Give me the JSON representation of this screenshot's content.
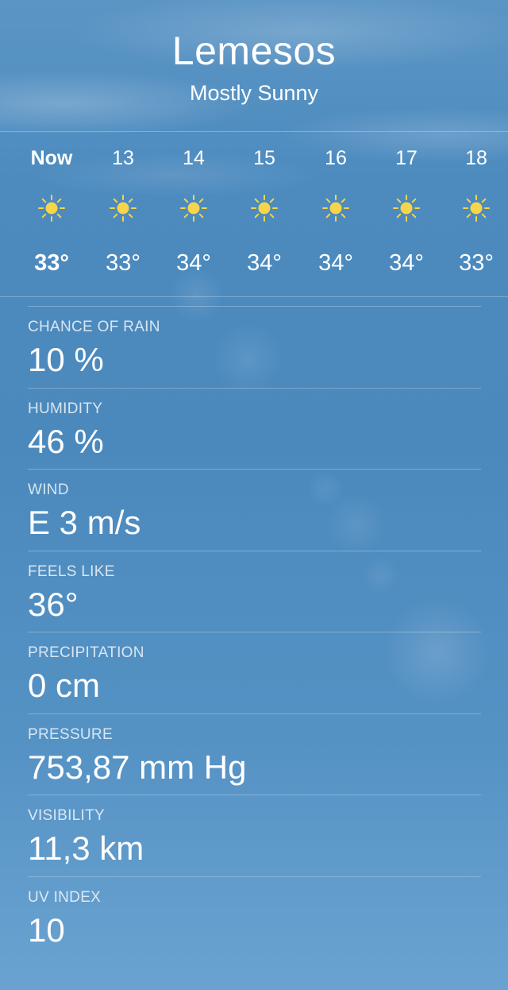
{
  "location": {
    "city": "Lemesos",
    "condition": "Mostly Sunny"
  },
  "hourly": [
    {
      "time": "Now",
      "icon": "sun-icon",
      "temp": "33°"
    },
    {
      "time": "13",
      "icon": "sun-icon",
      "temp": "33°"
    },
    {
      "time": "14",
      "icon": "sun-icon",
      "temp": "34°"
    },
    {
      "time": "15",
      "icon": "sun-icon",
      "temp": "34°"
    },
    {
      "time": "16",
      "icon": "sun-icon",
      "temp": "34°"
    },
    {
      "time": "17",
      "icon": "sun-icon",
      "temp": "34°"
    },
    {
      "time": "18",
      "icon": "sun-icon",
      "temp": "33°"
    }
  ],
  "details": [
    {
      "label": "CHANCE OF RAIN",
      "value": "10 %"
    },
    {
      "label": "HUMIDITY",
      "value": "46 %"
    },
    {
      "label": "WIND",
      "value": "E 3 m/s"
    },
    {
      "label": "FEELS LIKE",
      "value": "36°"
    },
    {
      "label": "PRECIPITATION",
      "value": "0 cm"
    },
    {
      "label": "PRESSURE",
      "value": "753,87 mm Hg"
    },
    {
      "label": "VISIBILITY",
      "value": "11,3 km"
    },
    {
      "label": "UV INDEX",
      "value": "10"
    }
  ],
  "colors": {
    "sun": "#f6d54a",
    "background": "#4b89bd"
  }
}
